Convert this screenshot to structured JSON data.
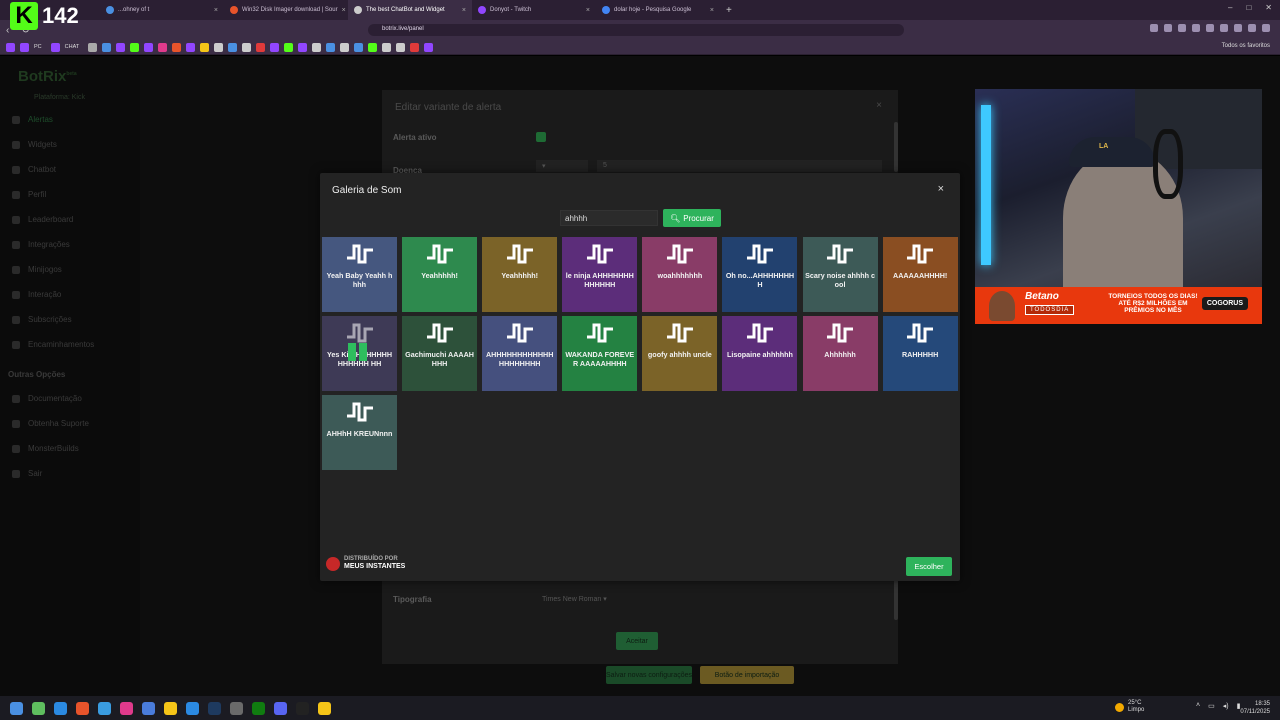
{
  "overlay_counter": {
    "logo_letter": "K",
    "value": "142"
  },
  "browser": {
    "tabs": [
      {
        "title": "...ohney of t",
        "color": "#4a90e2",
        "active": false
      },
      {
        "title": "Win32 Disk Imager download | Sour",
        "color": "#e8542b",
        "active": false
      },
      {
        "title": "The best ChatBot and Widget",
        "color": "#ccc",
        "active": true
      },
      {
        "title": "Donyot - Twitch",
        "color": "#9146ff",
        "active": false
      },
      {
        "title": "dolar hoje - Pesquisa Google",
        "color": "#4285f4",
        "active": false
      }
    ],
    "url": "botrix.live/panel",
    "bookmarks_visible_text": [
      "PC",
      "CHAT"
    ],
    "all_bookmarks_label": "Todos os favoritos"
  },
  "sidebar": {
    "brand": "BotRix",
    "brand_badge": "beta",
    "platform": "Plataforma: Kick",
    "items": [
      "Alertas",
      "Widgets",
      "Chatbot",
      "Perfil",
      "Leaderboard",
      "Integrações",
      "Minijogos",
      "Interação",
      "Subscrições",
      "Encaminhamentos"
    ],
    "section": "Outras Opções",
    "other_items": [
      "Documentação",
      "Obtenha Suporte",
      "MonsterBuilds",
      "Sair"
    ]
  },
  "background_dialog": {
    "title": "Editar variante de alerta",
    "label_active": "Alerta ativo",
    "label_doenca": "Doença",
    "doenca_value": "5",
    "label_font": "Tipografia",
    "font_value": "Times New Roman",
    "accept_label": "Aceitar",
    "footer_btn1": "Salvar novas configurações",
    "footer_btn2": "Botão de importação"
  },
  "sound_gallery": {
    "title": "Galeria de Som",
    "search_value": "ahhhh",
    "search_button": "Procurar",
    "sounds": [
      {
        "label": "Yeah Baby Yeahh hhhh",
        "color": "#45577f"
      },
      {
        "label": "Yeahhhhh!",
        "color": "#2e8a4e"
      },
      {
        "label": "Yeahhhhh!",
        "color": "#7b6328"
      },
      {
        "label": "le ninja AHHHHHHHHHHHHH",
        "color": "#5c2d7a"
      },
      {
        "label": "woahhhhhhh",
        "color": "#893c67"
      },
      {
        "label": "Oh no...AHHHHHHHH",
        "color": "#22416f"
      },
      {
        "label": "Scary noise ahhhh cool",
        "color": "#3d5a57"
      },
      {
        "label": "AAAAAAHHHH!",
        "color": "#8a4e22"
      },
      {
        "label": "Yes Ki HHHHHHHHHHHHHH HH",
        "color": "#3e3a56"
      },
      {
        "label": "Gachimuchi AAAAHHHH",
        "color": "#2d513a"
      },
      {
        "label": "AHHHHHHHHHHHHHHHHHHHH",
        "color": "#45507e"
      },
      {
        "label": "WAKANDA FOREVER AAAAAHHHH",
        "color": "#248242"
      },
      {
        "label": "goofy ahhhh uncle",
        "color": "#7b6328"
      },
      {
        "label": "Lisopaine ahhhhhh",
        "color": "#5c2d7a"
      },
      {
        "label": "Ahhhhhh",
        "color": "#893c67"
      },
      {
        "label": "RAHHHHH",
        "color": "#25497a"
      },
      {
        "label": "AHHhH KREUNnnn",
        "color": "#3d5a57"
      }
    ],
    "playing_index": 8,
    "credit_line1": "DISTRIBUÍDO POR",
    "credit_line2": "MEUS INSTANTES",
    "choose_button": "Escolher"
  },
  "webcam_banner": {
    "cap_logo": "LA",
    "brand": "Betano",
    "code": "TODOSDIA",
    "promo": "TORNEIOS TODOS OS DIAS! ATÉ R$2 MILHÕES EM PRÊMIOS NO MÊS",
    "cta": "COGORUS"
  },
  "taskbar": {
    "icon_colors": [
      "#4a90e2",
      "#5fbe5f",
      "#2b8ae2",
      "#e8542b",
      "#3a9ce0",
      "#e03a8c",
      "#4a7cdb",
      "#f5c518",
      "#2b8ae2",
      "#1e3a5f",
      "#6a6a6a",
      "#107c10",
      "#5865f2",
      "#222",
      "#f5c518"
    ],
    "weather_temp": "25°C",
    "weather_desc": "Limpo",
    "time": "18:35",
    "date": "07/11/2025"
  }
}
